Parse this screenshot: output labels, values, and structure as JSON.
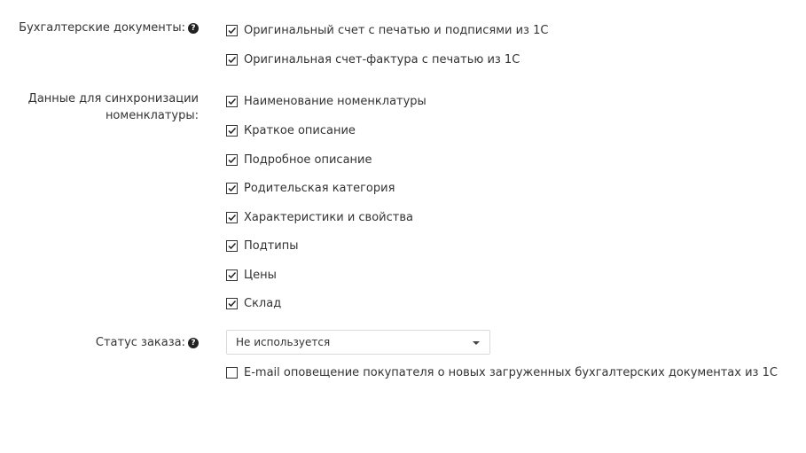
{
  "accounting_docs": {
    "label": "Бухгалтерские документы:",
    "help_icon": "question-circle-icon",
    "items": [
      {
        "label": "Оригинальный счет с печатью и подписями из 1С",
        "checked": true
      },
      {
        "label": "Оригинальная счет-фактура с печатью из 1С",
        "checked": true
      }
    ]
  },
  "sync": {
    "label_line1": "Данные для синхронизации",
    "label_line2": "номенклатуры:",
    "items": [
      {
        "label": "Наименование номенклатуры",
        "checked": true
      },
      {
        "label": "Краткое описание",
        "checked": true
      },
      {
        "label": "Подробное описание",
        "checked": true
      },
      {
        "label": "Родительская категория",
        "checked": true
      },
      {
        "label": "Характеристики и свойства",
        "checked": true
      },
      {
        "label": "Подтипы",
        "checked": true
      },
      {
        "label": "Цены",
        "checked": true
      },
      {
        "label": "Склад",
        "checked": true
      }
    ]
  },
  "order_status": {
    "label": "Статус заказа:",
    "help_icon": "question-circle-icon",
    "selected": "Не используется"
  },
  "email_notify": {
    "label": "E-mail оповещение покупателя о новых загруженных бухгалтерских документах из 1С",
    "checked": false
  }
}
